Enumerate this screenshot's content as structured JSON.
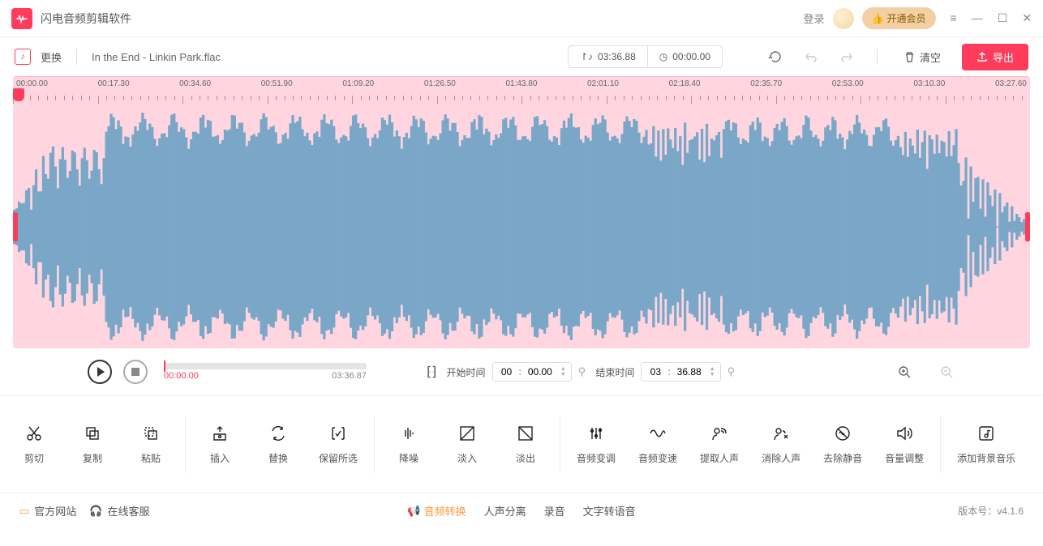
{
  "app": {
    "title": "闪电音频剪辑软件"
  },
  "titlebar": {
    "login": "登录",
    "vip": "开通会员"
  },
  "file": {
    "change": "更换",
    "name": "In the End - Linkin Park.flac"
  },
  "timebox": {
    "selection": "03:36.88",
    "cursor": "00:00.00"
  },
  "actions": {
    "clear": "清空",
    "export": "导出"
  },
  "ruler": [
    "00:00.00",
    "00:17.30",
    "00:34.60",
    "00:51.90",
    "01:09.20",
    "01:26.50",
    "01:43.80",
    "02:01.10",
    "02:18.40",
    "02:35.70",
    "02:53.00",
    "03:10.30",
    "03:27.60"
  ],
  "play": {
    "current": "00:00.00",
    "duration": "03:36.87"
  },
  "range": {
    "start_label": "开始时间",
    "end_label": "结束时间",
    "start_mm": "00",
    "start_ss": "00.00",
    "end_mm": "03",
    "end_ss": "36.88"
  },
  "tools": {
    "edit": [
      {
        "id": "cut",
        "label": "剪切"
      },
      {
        "id": "copy",
        "label": "复制"
      },
      {
        "id": "paste",
        "label": "粘贴"
      }
    ],
    "insert": [
      {
        "id": "insert",
        "label": "插入"
      },
      {
        "id": "replace",
        "label": "替换"
      },
      {
        "id": "keep-selection",
        "label": "保留所选"
      }
    ],
    "fade": [
      {
        "id": "noise-reduce",
        "label": "降噪"
      },
      {
        "id": "fade-in",
        "label": "淡入"
      },
      {
        "id": "fade-out",
        "label": "淡出"
      }
    ],
    "audio": [
      {
        "id": "pitch",
        "label": "音频变调"
      },
      {
        "id": "speed",
        "label": "音频变速"
      },
      {
        "id": "extract-vocal",
        "label": "提取人声"
      },
      {
        "id": "remove-vocal",
        "label": "消除人声"
      },
      {
        "id": "remove-silence",
        "label": "去除静音"
      },
      {
        "id": "volume",
        "label": "音量调整"
      }
    ],
    "bg": [
      {
        "id": "add-bgm",
        "label": "添加背景音乐"
      }
    ]
  },
  "footer": {
    "official": "官方网站",
    "support": "在线客服",
    "links": [
      "音频转换",
      "人声分离",
      "录音",
      "文字转语音"
    ],
    "version_label": "版本号：",
    "version": "v4.1.6"
  }
}
